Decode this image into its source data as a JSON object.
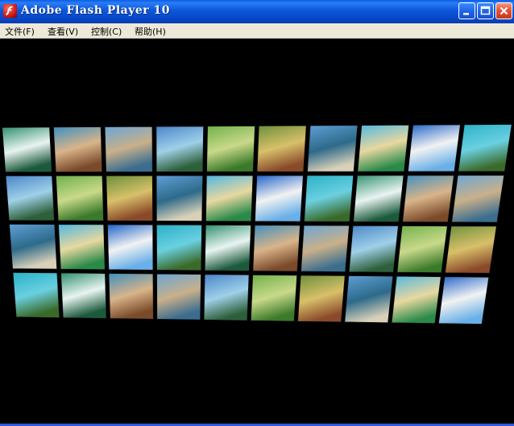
{
  "window": {
    "title": "Adobe Flash Player 10",
    "app_icon": "flash-player-icon",
    "controls": [
      "minimize-icon",
      "maximize-icon",
      "close-icon"
    ]
  },
  "menu": {
    "items": [
      {
        "label": "文件(F)"
      },
      {
        "label": "查看(V)"
      },
      {
        "label": "控制(C)"
      },
      {
        "label": "帮助(H)"
      }
    ]
  },
  "gallery": {
    "rows": 4,
    "columns": 10,
    "colors": {
      "background": "#000000",
      "titlebar": "#0b57da",
      "menubar": "#ece9d8"
    }
  }
}
